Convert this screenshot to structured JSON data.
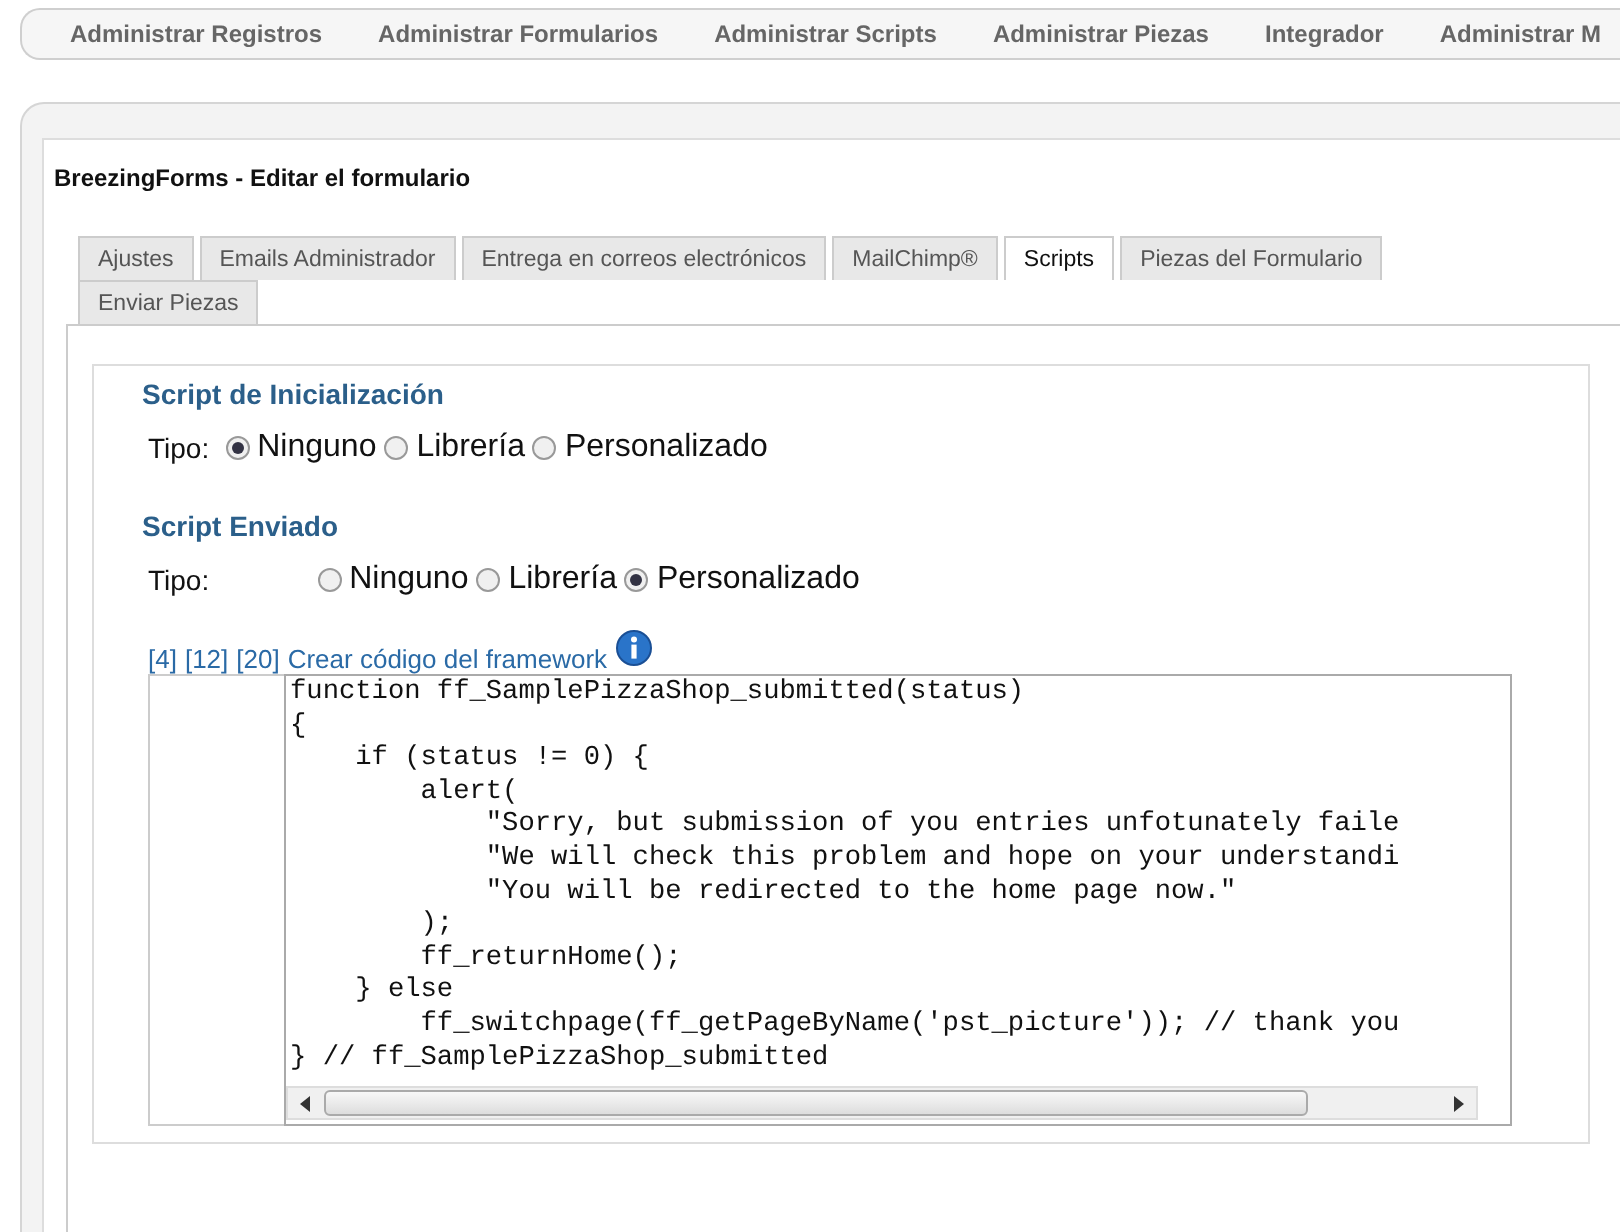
{
  "top_nav": {
    "items": [
      "Administrar Registros",
      "Administrar Formularios",
      "Administrar Scripts",
      "Administrar Piezas",
      "Integrador",
      "Administrar M"
    ]
  },
  "panel": {
    "title": "BreezingForms - Editar el formulario"
  },
  "tabs": [
    {
      "label": "Ajustes",
      "selected": false
    },
    {
      "label": "Emails Administrador",
      "selected": false
    },
    {
      "label": "Entrega en correos electrónicos",
      "selected": false
    },
    {
      "label": "MailChimp®",
      "selected": false
    },
    {
      "label": "Scripts",
      "selected": true
    },
    {
      "label": "Piezas del Formulario",
      "selected": false
    },
    {
      "label": "Enviar Piezas",
      "selected": false
    }
  ],
  "sections": [
    {
      "heading": "Script de Inicialización",
      "type_label": "Tipo:",
      "options": [
        {
          "label": "Ninguno",
          "selected": true
        },
        {
          "label": "Librería",
          "selected": false
        },
        {
          "label": "Personalizado",
          "selected": false
        }
      ]
    },
    {
      "heading": "Script Enviado",
      "type_label": "Tipo:",
      "options": [
        {
          "label": "Ninguno",
          "selected": false
        },
        {
          "label": "Librería",
          "selected": false
        },
        {
          "label": "Personalizado",
          "selected": true
        }
      ],
      "links": [
        "[4]",
        "[12]",
        "[20]",
        "Crear código del framework"
      ],
      "code_lines": [
        "function ff_SamplePizzaShop_submitted(status)",
        "{",
        "    if (status != 0) {",
        "        alert(",
        "            \"Sorry, but submission of you entries unfotunately faile",
        "            \"We will check this problem and hope on your understandi",
        "            \"You will be redirected to the home page now.\"",
        "        );",
        "        ff_returnHome();",
        "    } else",
        "        ff_switchpage(ff_getPageByName('pst_picture')); // thank you",
        "} // ff_SamplePizzaShop_submitted"
      ]
    }
  ]
}
